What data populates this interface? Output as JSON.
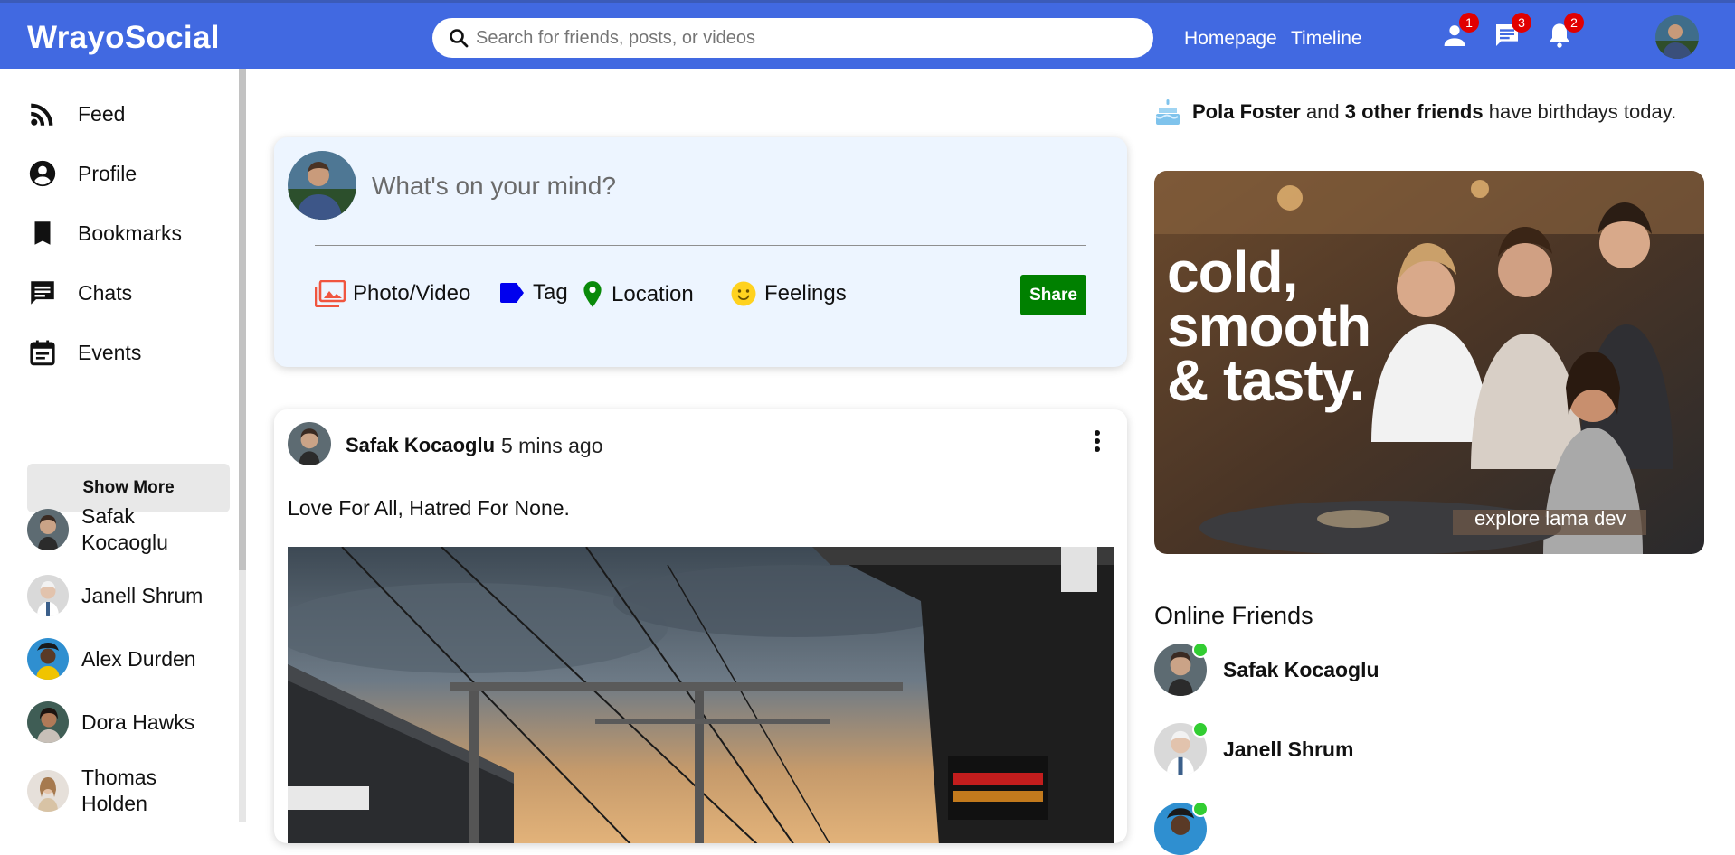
{
  "header": {
    "brand": "WrayoSocial",
    "search_placeholder": "Search for friends, posts, or videos",
    "links": [
      "Homepage",
      "Timeline"
    ],
    "badges": {
      "friends": "1",
      "chats": "3",
      "notifications": "2"
    }
  },
  "sidebar": {
    "items": [
      {
        "label": "Feed",
        "icon": "rss-feed-icon"
      },
      {
        "label": "Profile",
        "icon": "account-circle-icon"
      },
      {
        "label": "Bookmarks",
        "icon": "bookmark-icon"
      },
      {
        "label": "Chats",
        "icon": "chat-icon"
      },
      {
        "label": "Events",
        "icon": "event-calendar-icon"
      }
    ],
    "show_more": "Show More",
    "friends": [
      {
        "line1": "Safak",
        "line2": "Kocaoglu"
      },
      {
        "line1": "Janell Shrum",
        "line2": ""
      },
      {
        "line1": "Alex Durden",
        "line2": ""
      },
      {
        "line1": "Dora Hawks",
        "line2": ""
      },
      {
        "line1": "Thomas",
        "line2": "Holden"
      }
    ]
  },
  "share": {
    "placeholder": "What's on your mind?",
    "options": [
      "Photo/Video",
      "Tag",
      "Location",
      "Feelings"
    ],
    "button": "Share"
  },
  "post": {
    "author": "Safak Kocaoglu",
    "time": "5 mins ago",
    "text": "Love For All, Hatred For None."
  },
  "rightbar": {
    "birthday": {
      "name": "Pola Foster",
      "and": "and",
      "others": "3 other friends",
      "suffix": "have birthdays today."
    },
    "ad": {
      "line1": "cold,",
      "line2": "smooth",
      "line3": "& tasty.",
      "sub": "explore lama dev"
    },
    "online_title": "Online Friends",
    "online": [
      "Safak Kocaoglu",
      "Janell Shrum"
    ]
  },
  "colors": {
    "header": "#4169e1",
    "share_bg": "#edf5ff",
    "share_button": "#008000",
    "badge": "#e10000",
    "online_dot": "#32cd32"
  }
}
